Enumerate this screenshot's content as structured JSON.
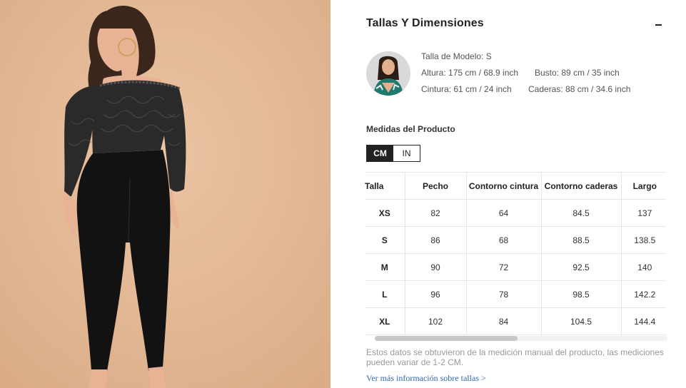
{
  "photo": {
    "alt_description": ""
  },
  "header": {
    "title": "Tallas Y Dimensiones"
  },
  "model": {
    "size_label": "Talla de Modelo: S",
    "height": "Altura: 175 cm / 68.9 inch",
    "bust": "Busto: 89 cm / 35 inch",
    "waist": "Cintura: 61 cm / 24 inch",
    "hips": "Caderas: 88 cm / 34.6 inch"
  },
  "measures": {
    "title": "Medidas del Producto",
    "units": [
      "CM",
      "IN"
    ],
    "active_unit": "CM"
  },
  "table": {
    "headers": [
      "Talla",
      "Pecho",
      "Contorno cintura",
      "Contorno caderas",
      "Largo"
    ],
    "rows": [
      [
        "XS",
        "82",
        "64",
        "84.5",
        "137"
      ],
      [
        "S",
        "86",
        "68",
        "88.5",
        "138.5"
      ],
      [
        "M",
        "90",
        "72",
        "92.5",
        "140"
      ],
      [
        "L",
        "96",
        "78",
        "98.5",
        "142.2"
      ],
      [
        "XL",
        "102",
        "84",
        "104.5",
        "144.4"
      ]
    ]
  },
  "note": "Estos datos se obtuvieron de la medición manual del producto, las mediciones pueden variar de 1-2 CM.",
  "more_link": "Ver más información sobre tallas >",
  "colors": {
    "accent": "#222222",
    "link": "#2e6ab3",
    "photo_bg": "#e4b896"
  }
}
